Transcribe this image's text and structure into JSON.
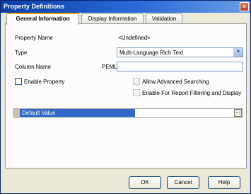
{
  "window": {
    "title": "Property Definitions",
    "close_symbol": "×"
  },
  "tabs": [
    {
      "label": "General Information",
      "active": true
    },
    {
      "label": "Display Information",
      "active": false
    },
    {
      "label": "Validation",
      "active": false
    }
  ],
  "form": {
    "property_name_label": "Property Name",
    "property_name_value": "<Undefined>",
    "type_label": "Type",
    "type_value": "Multi-Language Rich Text",
    "column_name_label": "Column Name",
    "column_prefix": "PEML",
    "column_name_value": "",
    "enable_property_label": "Enable Property",
    "allow_advanced_searching_label": "Allow Advanced Searching",
    "enable_report_filtering_label": "Enable For Report Filtering and Display",
    "default_value_label": "Default Value",
    "default_value_button": "..."
  },
  "buttons": {
    "ok": "OK",
    "cancel": "Cancel",
    "help": "Help"
  },
  "colors": {
    "title_bar": "#0a3fa6",
    "selection": "#3169c6",
    "tab_highlight": "#f2a10a",
    "dialog_bg": "#ece9d8"
  },
  "icons": {
    "close": "close-icon",
    "dropdown": "chevron-down-icon"
  }
}
